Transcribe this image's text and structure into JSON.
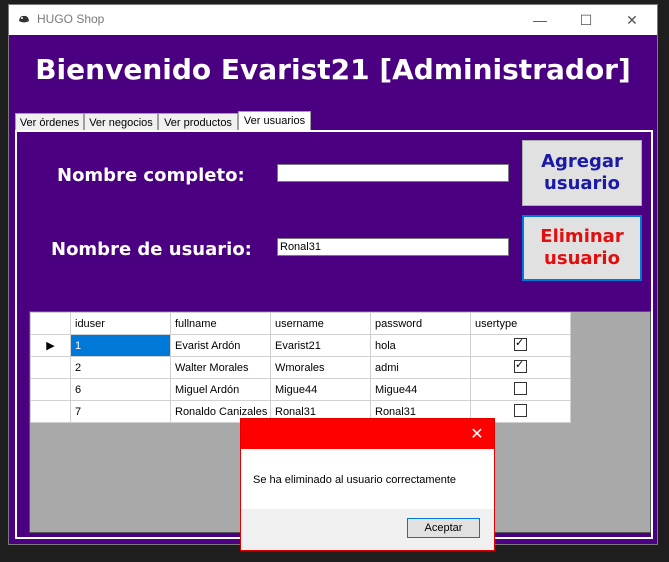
{
  "window": {
    "title": "HUGO Shop",
    "welcome": "Bienvenido Evarist21 [Administrador]"
  },
  "tabs": [
    {
      "label": "Ver órdenes"
    },
    {
      "label": "Ver negocios"
    },
    {
      "label": "Ver productos"
    },
    {
      "label": "Ver usuarios"
    }
  ],
  "form": {
    "fullname_label": "Nombre completo:",
    "fullname_value": "",
    "username_label": "Nombre de usuario:",
    "username_value": "Ronal31",
    "add_button": "Agregar usuario",
    "delete_button": "Eliminar usuario",
    "add_color": "#1a1aa6",
    "delete_color": "#e01010"
  },
  "grid": {
    "columns": [
      "iduser",
      "fullname",
      "username",
      "password",
      "usertype"
    ],
    "rows": [
      {
        "iduser": "1",
        "fullname": "Evarist Ardón",
        "username": "Evarist21",
        "password": "hola",
        "usertype": true
      },
      {
        "iduser": "2",
        "fullname": "Walter Morales",
        "username": "Wmorales",
        "password": "admi",
        "usertype": true
      },
      {
        "iduser": "6",
        "fullname": "Miguel Ardón",
        "username": "Migue44",
        "password": "Migue44",
        "usertype": false
      },
      {
        "iduser": "7",
        "fullname": "Ronaldo Canizales",
        "username": "Ronal31",
        "password": "Ronal31",
        "usertype": false
      }
    ]
  },
  "dialog": {
    "message": "Se ha eliminado al usuario correctamente",
    "ok_label": "Aceptar"
  }
}
